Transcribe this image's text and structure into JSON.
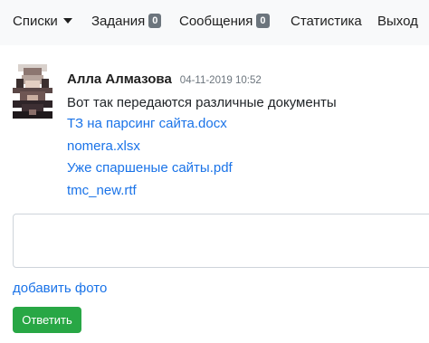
{
  "nav": {
    "lists_label": "Списки",
    "tasks_label": "Задания",
    "tasks_count": "0",
    "messages_label": "Сообщения",
    "messages_count": "0",
    "stats_label": "Статистика",
    "exit_label": "Выход"
  },
  "message": {
    "author": "Алла Алмазова",
    "timestamp": "04-11-2019 10:52",
    "text": "Вот так передаются различные документы",
    "files": [
      "ТЗ на парсинг сайта.docx",
      "nomera.xlsx",
      "Уже спаршеные сайты.pdf",
      "tmc_new.rtf"
    ]
  },
  "reply": {
    "add_photo_label": "добавить фото",
    "submit_label": "Ответить"
  },
  "colors": {
    "nav_bg": "#f8f9fa",
    "badge": "#6c757d",
    "link": "#1a73e8",
    "button": "#28a745"
  }
}
